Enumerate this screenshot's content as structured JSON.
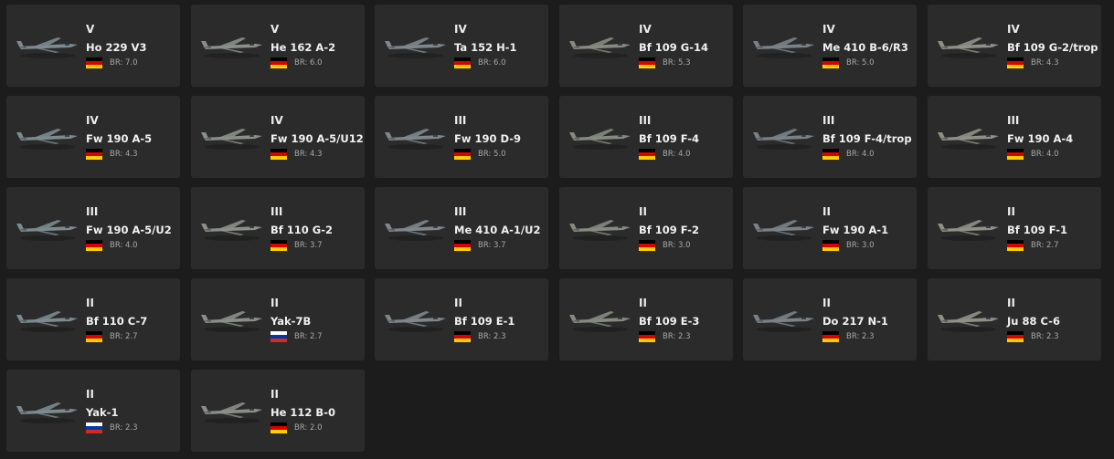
{
  "br_prefix": "BR: ",
  "flag_colors": {
    "germany": [
      "#000000",
      "#dd0000",
      "#ffce00"
    ],
    "russia": [
      "#ffffff",
      "#0039a6",
      "#d52b1e"
    ]
  },
  "vehicles": [
    {
      "rank": "V",
      "name": "Ho 229 V3",
      "nation": "germany",
      "br": "7.0"
    },
    {
      "rank": "V",
      "name": "He 162 A-2",
      "nation": "germany",
      "br": "6.0"
    },
    {
      "rank": "IV",
      "name": "Ta 152 H-1",
      "nation": "germany",
      "br": "6.0"
    },
    {
      "rank": "IV",
      "name": "Bf 109 G-14",
      "nation": "germany",
      "br": "5.3"
    },
    {
      "rank": "IV",
      "name": "Me 410 B-6/R3",
      "nation": "germany",
      "br": "5.0"
    },
    {
      "rank": "IV",
      "name": "Bf 109 G-2/trop",
      "nation": "germany",
      "br": "4.3"
    },
    {
      "rank": "IV",
      "name": "Fw 190 A-5",
      "nation": "germany",
      "br": "4.3"
    },
    {
      "rank": "IV",
      "name": "Fw 190 A-5/U12",
      "nation": "germany",
      "br": "4.3"
    },
    {
      "rank": "III",
      "name": "Fw 190 D-9",
      "nation": "germany",
      "br": "5.0"
    },
    {
      "rank": "III",
      "name": "Bf 109 F-4",
      "nation": "germany",
      "br": "4.0"
    },
    {
      "rank": "III",
      "name": "Bf 109 F-4/trop",
      "nation": "germany",
      "br": "4.0"
    },
    {
      "rank": "III",
      "name": "Fw 190 A-4",
      "nation": "germany",
      "br": "4.0"
    },
    {
      "rank": "III",
      "name": "Fw 190 A-5/U2",
      "nation": "germany",
      "br": "4.0"
    },
    {
      "rank": "III",
      "name": "Bf 110 G-2",
      "nation": "germany",
      "br": "3.7"
    },
    {
      "rank": "III",
      "name": "Me 410 A-1/U2",
      "nation": "germany",
      "br": "3.7"
    },
    {
      "rank": "II",
      "name": "Bf 109 F-2",
      "nation": "germany",
      "br": "3.0"
    },
    {
      "rank": "II",
      "name": "Fw 190 A-1",
      "nation": "germany",
      "br": "3.0"
    },
    {
      "rank": "II",
      "name": "Bf 109 F-1",
      "nation": "germany",
      "br": "2.7"
    },
    {
      "rank": "II",
      "name": "Bf 110 C-7",
      "nation": "germany",
      "br": "2.7"
    },
    {
      "rank": "II",
      "name": "Yak-7B",
      "nation": "russia",
      "br": "2.7"
    },
    {
      "rank": "II",
      "name": "Bf 109 E-1",
      "nation": "germany",
      "br": "2.3"
    },
    {
      "rank": "II",
      "name": "Bf 109 E-3",
      "nation": "germany",
      "br": "2.3"
    },
    {
      "rank": "II",
      "name": "Do 217 N-1",
      "nation": "germany",
      "br": "2.3"
    },
    {
      "rank": "II",
      "name": "Ju 88 C-6",
      "nation": "germany",
      "br": "2.3"
    },
    {
      "rank": "II",
      "name": "Yak-1",
      "nation": "russia",
      "br": "2.3"
    },
    {
      "rank": "II",
      "name": "He 112 B-0",
      "nation": "germany",
      "br": "2.0"
    }
  ]
}
